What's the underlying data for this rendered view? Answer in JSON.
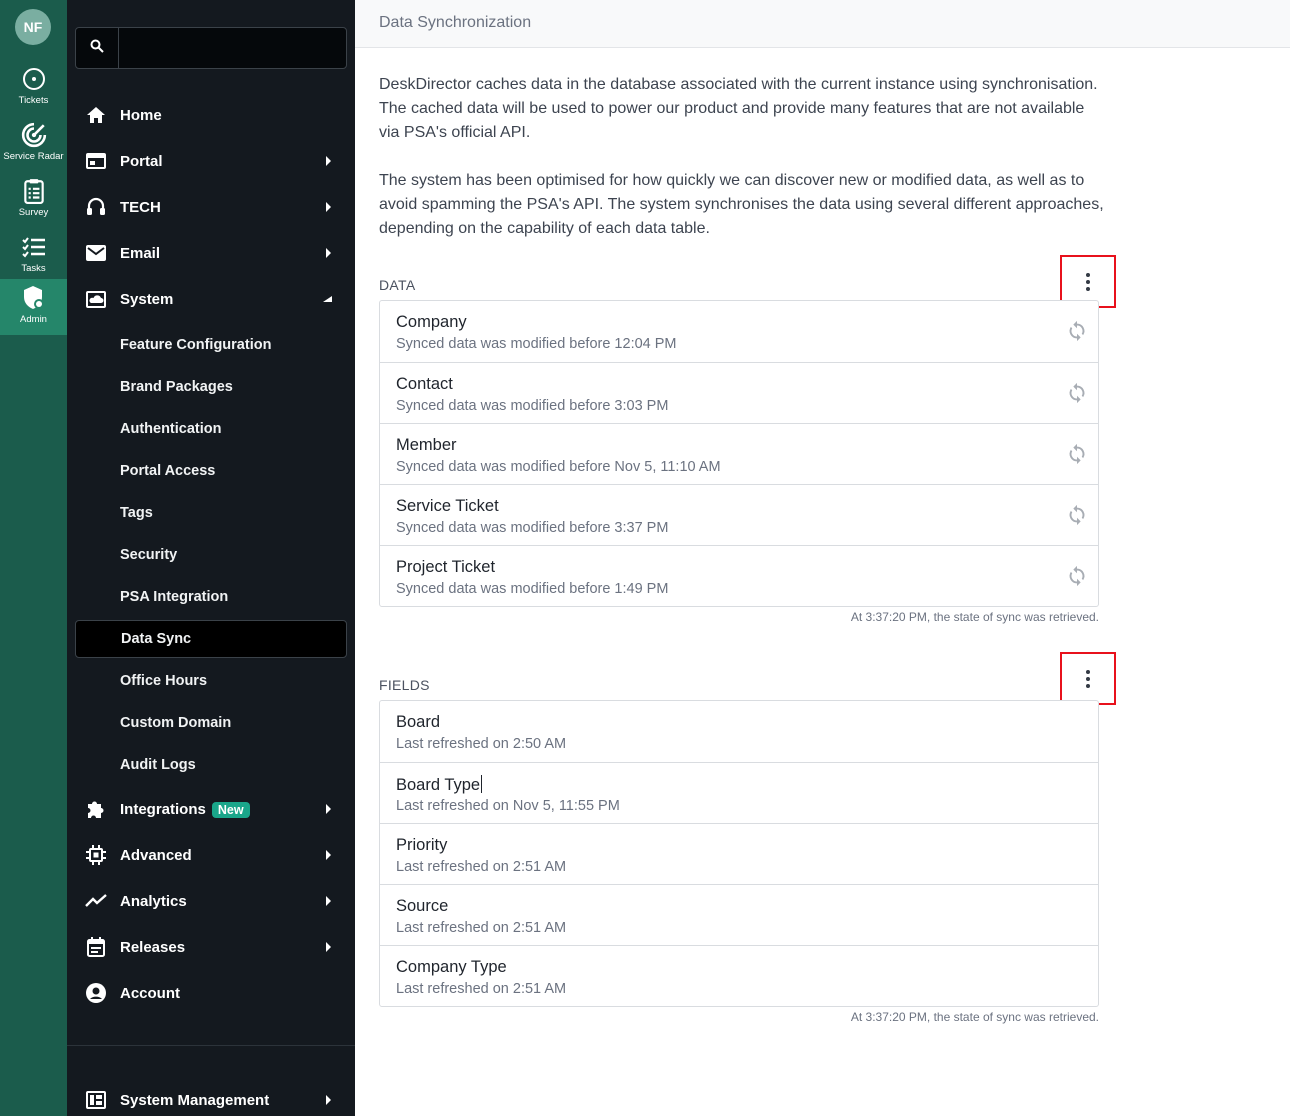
{
  "rail": {
    "avatar": "NF",
    "items": [
      {
        "label": "Tickets",
        "icon": "tickets-icon"
      },
      {
        "label": "Service Radar",
        "icon": "radar-icon"
      },
      {
        "label": "Survey",
        "icon": "clipboard-icon"
      },
      {
        "label": "Tasks",
        "icon": "checklist-icon"
      },
      {
        "label": "Admin",
        "icon": "admin-shield-icon",
        "active": true
      }
    ]
  },
  "nav": {
    "search": {
      "value": "",
      "placeholder": ""
    },
    "items": [
      {
        "label": "Home",
        "icon": "home-icon"
      },
      {
        "label": "Portal",
        "icon": "portal-icon"
      },
      {
        "label": "TECH",
        "icon": "headset-icon"
      },
      {
        "label": "Email",
        "icon": "mail-icon"
      },
      {
        "label": "System",
        "icon": "cloud-monitor-icon"
      }
    ],
    "system_sub": [
      "Feature Configuration",
      "Brand Packages",
      "Authentication",
      "Portal Access",
      "Tags",
      "Security",
      "PSA Integration",
      "Data Sync",
      "Office Hours",
      "Custom Domain",
      "Audit Logs"
    ],
    "active_sub": "Data Sync",
    "items_after": [
      {
        "label": "Integrations",
        "icon": "puzzle-icon",
        "badge": "New"
      },
      {
        "label": "Advanced",
        "icon": "chip-icon"
      },
      {
        "label": "Analytics",
        "icon": "trend-icon"
      },
      {
        "label": "Releases",
        "icon": "calendar-icon"
      },
      {
        "label": "Account",
        "icon": "account-icon"
      }
    ],
    "bottom": {
      "label": "System Management",
      "icon": "dashboard-icon"
    }
  },
  "page": {
    "title": "Data Synchronization",
    "intro_p1": "DeskDirector caches data in the database associated with the current instance using synchronisation. The cached data will be used to power our product and provide many features that are not available via PSA's official API.",
    "intro_p2": "The system has been optimised for how quickly we can discover new or modified data, as well as to avoid spamming the PSA's API. The system synchronises the data using several different approaches, depending on the capability of each data table."
  },
  "data_section": {
    "label": "DATA",
    "rows": [
      {
        "title": "Company",
        "sub": "Synced data was modified before 12:04 PM"
      },
      {
        "title": "Contact",
        "sub": "Synced data was modified before 3:03 PM"
      },
      {
        "title": "Member",
        "sub": "Synced data was modified before Nov 5, 11:10 AM"
      },
      {
        "title": "Service Ticket",
        "sub": "Synced data was modified before 3:37 PM"
      },
      {
        "title": "Project Ticket",
        "sub": "Synced data was modified before 1:49 PM"
      }
    ],
    "footer": "At 3:37:20 PM, the state of sync was retrieved."
  },
  "fields_section": {
    "label": "FIELDS",
    "rows": [
      {
        "title": "Board",
        "sub": "Last refreshed on 2:50 AM"
      },
      {
        "title": "Board Type",
        "sub": "Last refreshed on Nov 5, 11:55 PM"
      },
      {
        "title": "Priority",
        "sub": "Last refreshed on 2:51 AM"
      },
      {
        "title": "Source",
        "sub": "Last refreshed on 2:51 AM"
      },
      {
        "title": "Company Type",
        "sub": "Last refreshed on 2:51 AM"
      }
    ],
    "footer": "At 3:37:20 PM, the state of sync was retrieved."
  },
  "colors": {
    "rail_bg": "#1b5c4c",
    "rail_active": "#25866a",
    "nav_bg": "#14191f",
    "badge_new": "#1aa68a",
    "highlight_box": "#e8111c"
  }
}
